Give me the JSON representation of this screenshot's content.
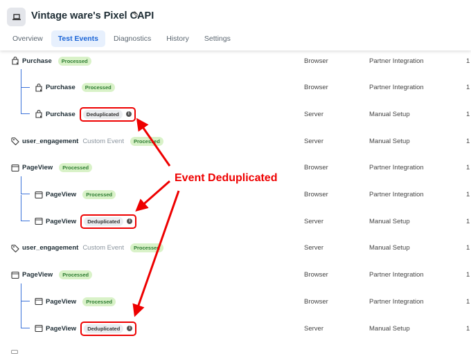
{
  "header": {
    "title": "Vintage ware's Pixel CAPI",
    "app_icon": "laptop-icon",
    "edit_icon": "pencil-icon"
  },
  "tabs": [
    {
      "label": "Overview",
      "active": false
    },
    {
      "label": "Test Events",
      "active": true
    },
    {
      "label": "Diagnostics",
      "active": false
    },
    {
      "label": "History",
      "active": false
    },
    {
      "label": "Settings",
      "active": false
    }
  ],
  "events": [
    {
      "name": "Purchase",
      "icon": "shopping-bag-icon",
      "level": 0,
      "status": "Processed",
      "source": "Browser",
      "setup": "Partner Integration",
      "count": "1"
    },
    {
      "name": "Purchase",
      "icon": "shopping-bag-icon",
      "level": 1,
      "status": "Processed",
      "source": "Browser",
      "setup": "Partner Integration",
      "count": "1"
    },
    {
      "name": "Purchase",
      "icon": "shopping-bag-icon",
      "level": 1,
      "status": "Deduplicated",
      "source": "Server",
      "setup": "Manual Setup",
      "count": "1"
    },
    {
      "name": "user_engagement",
      "sub": "Custom Event",
      "icon": "tag-icon",
      "level": 0,
      "status": "Processed",
      "source": "Server",
      "setup": "Manual Setup",
      "count": "1"
    },
    {
      "name": "PageView",
      "icon": "browser-window-icon",
      "level": 0,
      "status": "Processed",
      "source": "Browser",
      "setup": "Partner Integration",
      "count": "1"
    },
    {
      "name": "PageView",
      "icon": "browser-window-icon",
      "level": 1,
      "status": "Processed",
      "source": "Browser",
      "setup": "Partner Integration",
      "count": "1"
    },
    {
      "name": "PageView",
      "icon": "browser-window-icon",
      "level": 1,
      "status": "Deduplicated",
      "source": "Server",
      "setup": "Manual Setup",
      "count": "1"
    },
    {
      "name": "user_engagement",
      "sub": "Custom Event",
      "icon": "tag-icon",
      "level": 0,
      "status": "Processed",
      "source": "Server",
      "setup": "Manual Setup",
      "count": "1"
    },
    {
      "name": "PageView",
      "icon": "browser-window-icon",
      "level": 0,
      "status": "Processed",
      "source": "Browser",
      "setup": "Partner Integration",
      "count": "1"
    },
    {
      "name": "PageView",
      "icon": "browser-window-icon",
      "level": 1,
      "status": "Processed",
      "source": "Browser",
      "setup": "Partner Integration",
      "count": "1"
    },
    {
      "name": "PageView",
      "icon": "browser-window-icon",
      "level": 1,
      "status": "Deduplicated",
      "source": "Server",
      "setup": "Manual Setup",
      "count": "1"
    }
  ],
  "annotation": {
    "label": "Event Deduplicated",
    "color": "#ee0000"
  }
}
